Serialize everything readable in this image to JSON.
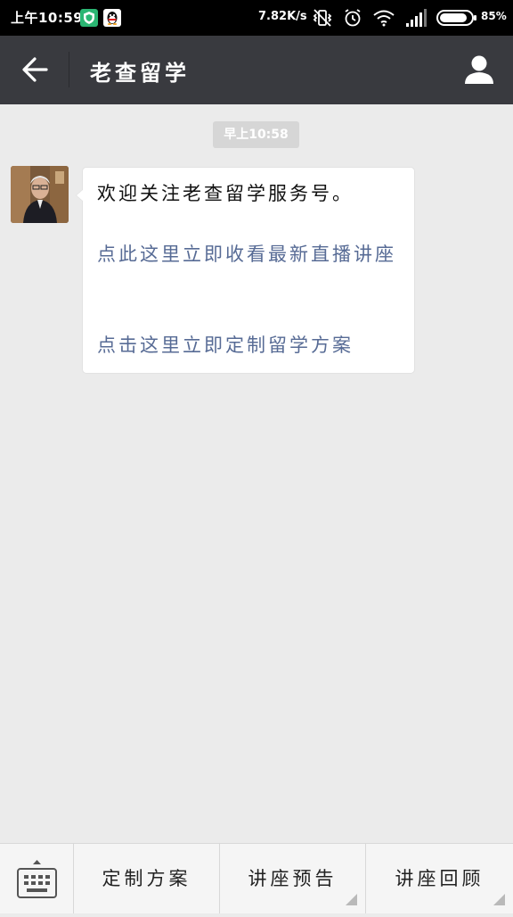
{
  "status_bar": {
    "time": "上午10:59",
    "network_speed": "7.82K/s",
    "battery": "85%",
    "icons": [
      "shield-app-icon",
      "qq-penguin-icon",
      "vibrate-off-icon",
      "alarm-icon",
      "wifi-icon",
      "signal-icon",
      "battery-icon"
    ]
  },
  "nav": {
    "title": "老查留学",
    "back_icon": "back-arrow-icon",
    "profile_icon": "person-icon"
  },
  "chat": {
    "timestamp": "早上10:58",
    "message": {
      "greeting": "欢迎关注老查留学服务号。",
      "link1": "点此这里立即收看最新直播讲座",
      "link2": "点击这里立即定制留学方案"
    }
  },
  "bottom_menu": {
    "keyboard_icon": "keyboard-icon",
    "items": [
      {
        "label": "定制方案",
        "has_submenu": false
      },
      {
        "label": "讲座预告",
        "has_submenu": true
      },
      {
        "label": "讲座回顾",
        "has_submenu": true
      }
    ]
  },
  "colors": {
    "nav_bg": "#393a3f",
    "link": "#576b95",
    "chat_bg": "#ebebeb"
  }
}
